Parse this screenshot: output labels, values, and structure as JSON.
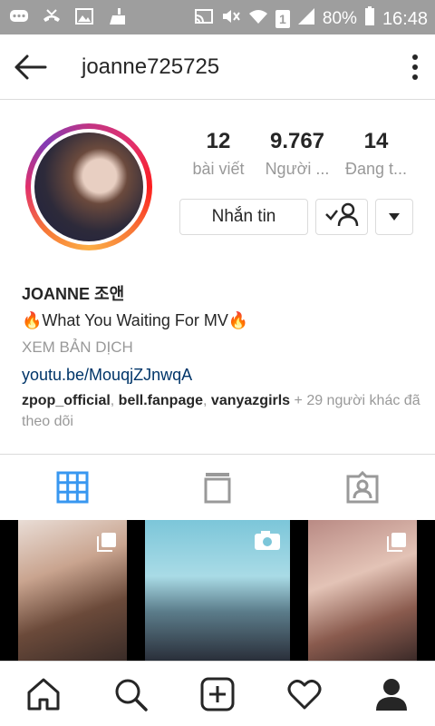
{
  "status_bar": {
    "battery": "80%",
    "time": "16:48",
    "sim_slot": "1"
  },
  "header": {
    "username": "joanne725725"
  },
  "profile": {
    "stats": [
      {
        "value": "12",
        "label": "bài viết"
      },
      {
        "value": "9.767",
        "label": "Người ..."
      },
      {
        "value": "14",
        "label": "Đang t..."
      }
    ],
    "message_button": "Nhắn tin"
  },
  "bio": {
    "display_name": "JOANNE 조앤",
    "fire_emoji": "🔥",
    "tagline": "What You Waiting For MV",
    "translate": "XEM BẢN DỊCH",
    "link": "youtu.be/MouqjZJnwqA",
    "followed_by": {
      "accounts": [
        "zpop_official",
        "bell.fanpage",
        "vanyazgirls"
      ],
      "separator": ", ",
      "rest": " + 29 người khác đã theo dõi"
    }
  },
  "colors": {
    "accent_blue": "#3897f0",
    "link_blue": "#003569",
    "muted_gray": "#999999",
    "status_bar_gray": "#9e9e9e"
  }
}
